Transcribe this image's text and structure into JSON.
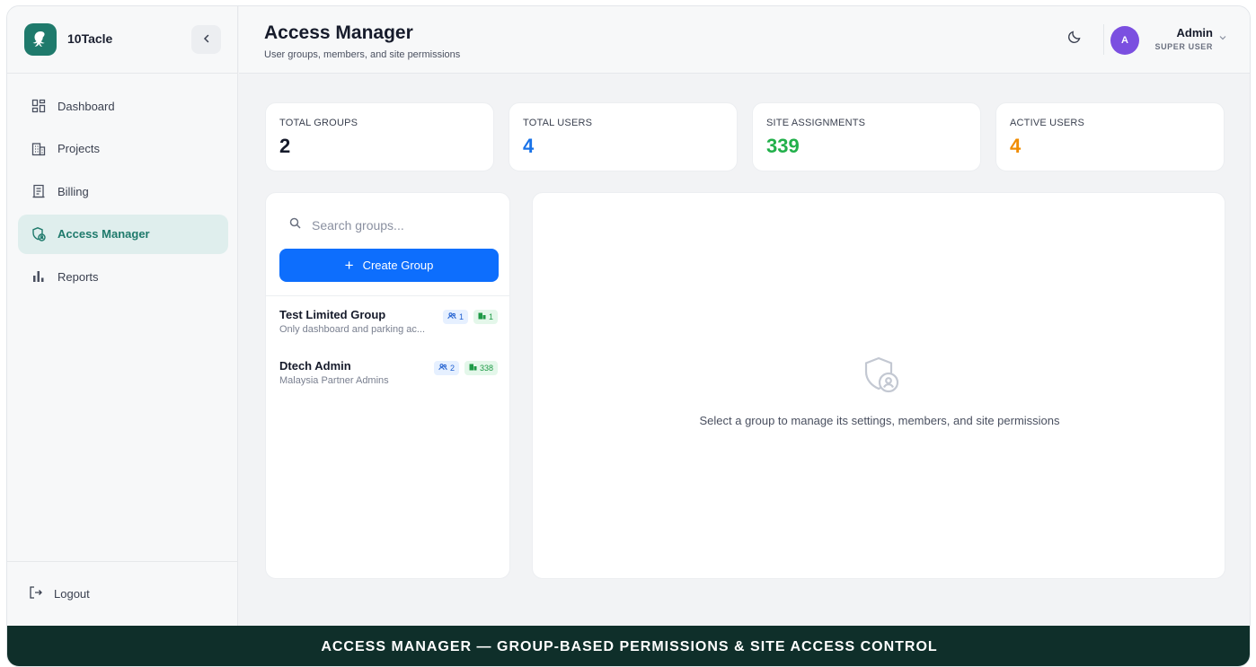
{
  "brand": {
    "name": "10Tacle",
    "icon": "octopus-logo"
  },
  "sidebar": {
    "items": [
      {
        "label": "Dashboard",
        "icon": "dashboard-icon"
      },
      {
        "label": "Projects",
        "icon": "building-icon"
      },
      {
        "label": "Billing",
        "icon": "receipt-icon"
      },
      {
        "label": "Access Manager",
        "icon": "access-icon",
        "active": true
      },
      {
        "label": "Reports",
        "icon": "bar-chart-icon"
      }
    ],
    "logout_label": "Logout"
  },
  "header": {
    "title": "Access Manager",
    "subtitle": "User groups, members, and site permissions",
    "user": {
      "initial": "A",
      "name": "Admin",
      "role": "SUPER USER"
    }
  },
  "stats": [
    {
      "label": "TOTAL GROUPS",
      "value": "2",
      "color": "#161b2b"
    },
    {
      "label": "TOTAL USERS",
      "value": "4",
      "color": "#1a73e8"
    },
    {
      "label": "SITE ASSIGNMENTS",
      "value": "339",
      "color": "#22b04b"
    },
    {
      "label": "ACTIVE USERS",
      "value": "4",
      "color": "#f08c00"
    }
  ],
  "groups_panel": {
    "search_placeholder": "Search groups...",
    "create_label": "Create Group",
    "groups": [
      {
        "name": "Test Limited Group",
        "description": "Only dashboard and parking ac...",
        "members": "1",
        "sites": "1"
      },
      {
        "name": "Dtech Admin",
        "description": "Malaysia Partner Admins",
        "members": "2",
        "sites": "338"
      }
    ]
  },
  "detail_panel": {
    "empty_message": "Select a group to manage its settings, members, and site permissions"
  },
  "banner": {
    "text": "ACCESS MANAGER — GROUP-BASED PERMISSIONS & SITE ACCESS CONTROL"
  },
  "colors": {
    "accent": "#1f7a6c",
    "primary": "#0d6efd",
    "banner_bg": "#0f2f2a"
  }
}
